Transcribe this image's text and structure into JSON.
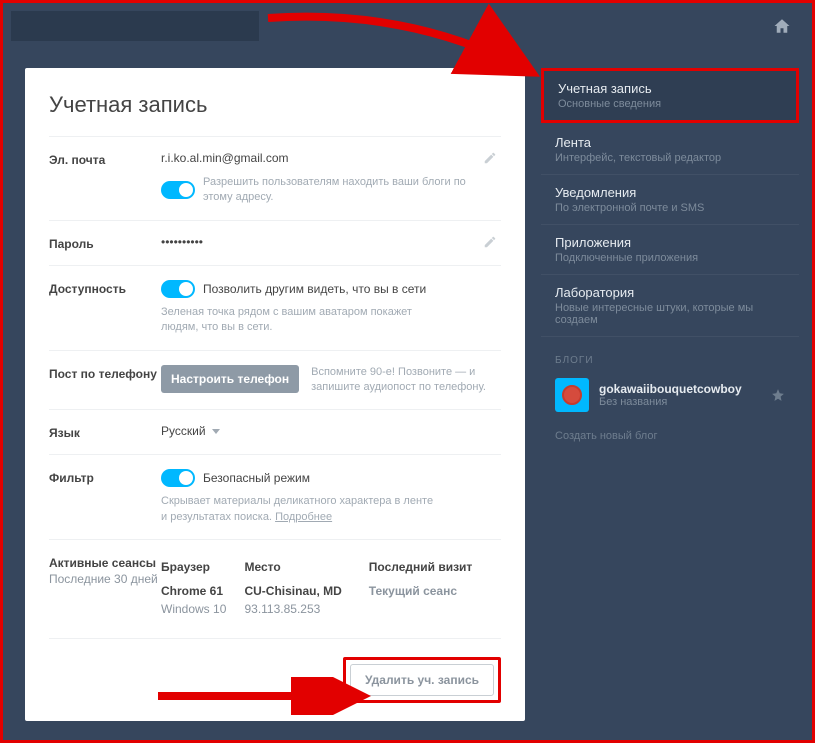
{
  "page_title": "Учетная запись",
  "email": {
    "label": "Эл. почта",
    "value": "r.i.ko.al.min@gmail.com",
    "toggle_text": "Разрешить пользователям находить ваши блоги по этому адресу."
  },
  "password": {
    "label": "Пароль",
    "value": "••••••••••"
  },
  "availability": {
    "label": "Доступность",
    "toggle_text": "Позволить другим видеть, что вы в сети",
    "help": "Зеленая точка рядом с вашим аватаром покажет людям, что вы в сети."
  },
  "phone": {
    "label": "Пост по телефону",
    "button": "Настроить телефон",
    "help": "Вспомните 90-е! Позвоните — и запишите аудиопост по телефону."
  },
  "language": {
    "label": "Язык",
    "value": "Русский"
  },
  "filter": {
    "label": "Фильтр",
    "toggle_text": "Безопасный режим",
    "help": "Скрывает материалы деликатного характера в ленте и результатах поиска.",
    "more": "Подробнее"
  },
  "sessions": {
    "label": "Активные сеансы",
    "sublabel": "Последние 30 дней",
    "col_browser": "Браузер",
    "col_place": "Место",
    "col_last": "Последний визит",
    "browser": "Chrome 61",
    "os": "Windows 10",
    "place": "CU-Chisinau, MD",
    "ip": "93.113.85.253",
    "current": "Текущий сеанс"
  },
  "delete_button": "Удалить уч. запись",
  "sidebar": {
    "items": [
      {
        "title": "Учетная запись",
        "sub": "Основные сведения"
      },
      {
        "title": "Лента",
        "sub": "Интерфейс, текстовый редактор"
      },
      {
        "title": "Уведомления",
        "sub": "По электронной почте и SMS"
      },
      {
        "title": "Приложения",
        "sub": "Подключенные приложения"
      },
      {
        "title": "Лаборатория",
        "sub": "Новые интересные штуки, которые мы создаем"
      }
    ],
    "blogs_label": "БЛОГИ",
    "blog_name": "gokawaiibouquetcowboy",
    "blog_sub": "Без названия",
    "create_blog": "Создать новый блог"
  }
}
